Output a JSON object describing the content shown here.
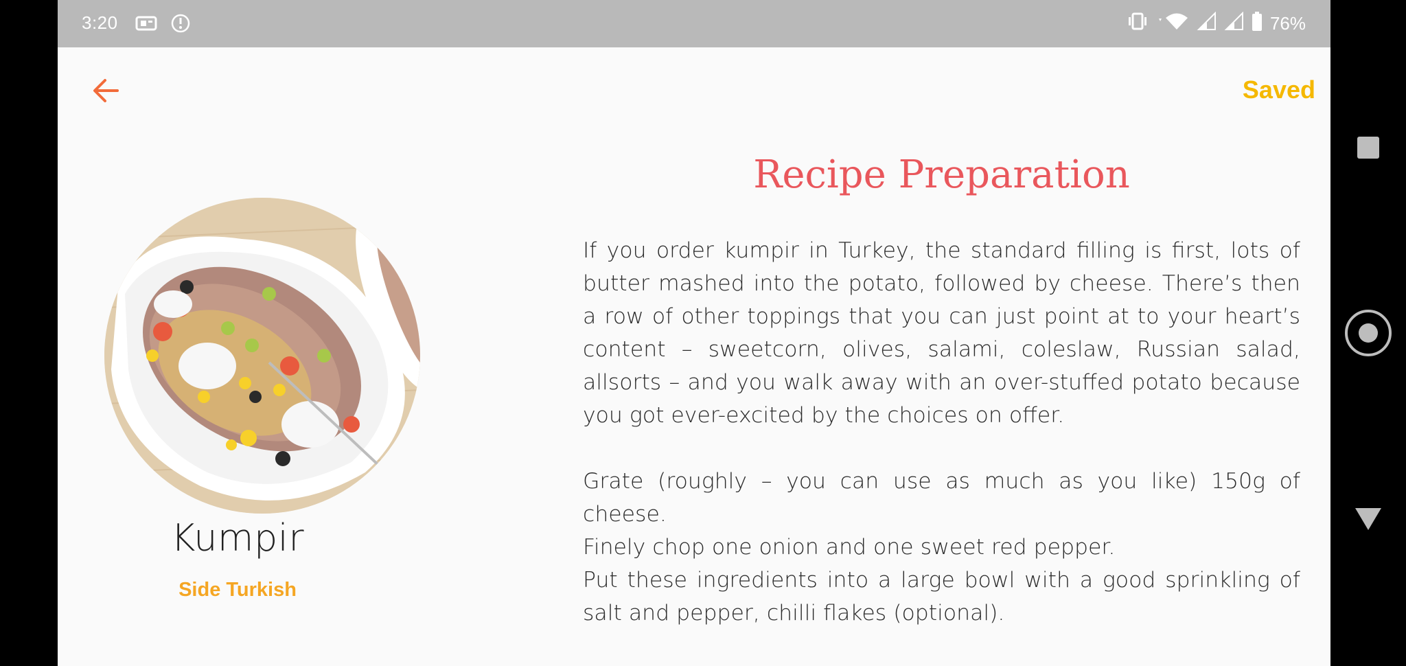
{
  "status_bar": {
    "time": "3:20",
    "battery_percent": "76%",
    "icons": [
      "vibrate-icon",
      "wifi-icon",
      "signal-icon",
      "signal-icon",
      "battery-icon"
    ]
  },
  "header": {
    "back_icon": "arrow-left-icon",
    "saved_label": "Saved"
  },
  "dish": {
    "name": "Kumpir",
    "tags": [
      "Side",
      "Turkish"
    ]
  },
  "recipe": {
    "title": "Recipe Preparation",
    "paragraph_1": "If you order kumpir in Turkey, the standard filling is first, lots of butter mashed into the potato, followed by cheese. There’s then a row of other toppings that you can just point at to your heart’s content – sweetcorn, olives, salami, coleslaw, Russian salad, allsorts – and you walk away with an over-stuffed potato because you got ever-excited by the choices on offer.",
    "step_1": "Grate (roughly – you can use as much as you like) 150g of cheese.",
    "step_2": "Finely chop one onion and one sweet red pepper.",
    "step_3": "Put these ingredients into a large bowl with a good sprinkling of salt and pepper, chilli flakes (optional)."
  },
  "colors": {
    "accent_orange": "#f26b3a",
    "saved_yellow": "#f5b800",
    "title_red": "#e9575c",
    "tag_orange": "#f5a623",
    "status_bar_gray": "#b9b9b9"
  }
}
